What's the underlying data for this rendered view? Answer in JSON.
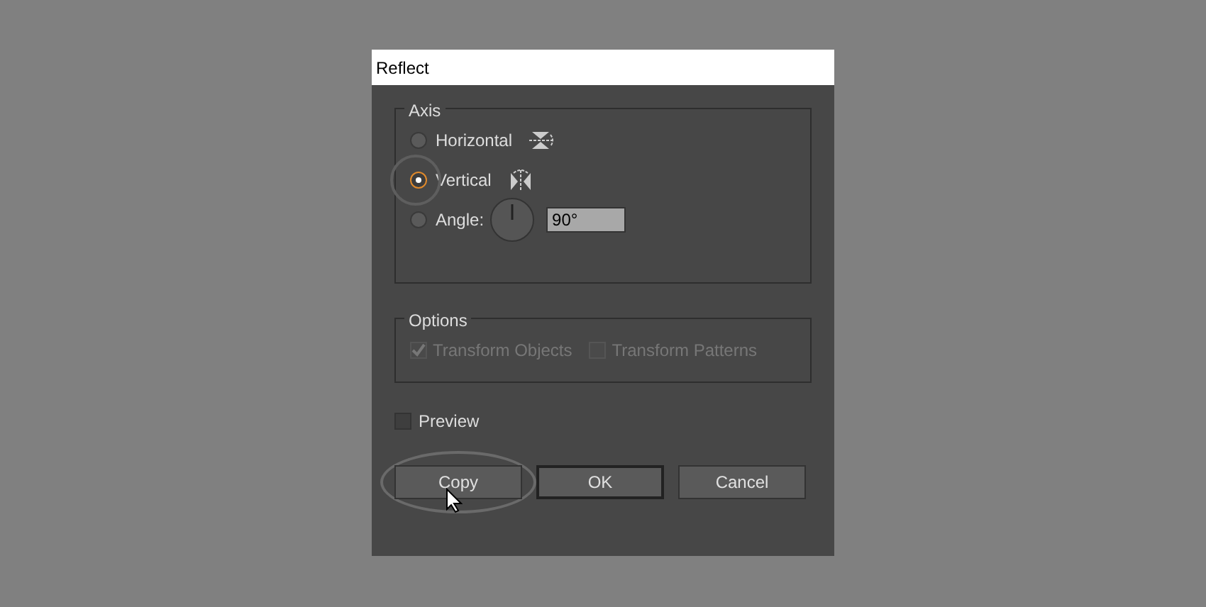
{
  "window": {
    "title": "Reflect"
  },
  "axis": {
    "label": "Axis",
    "options": [
      {
        "kind": "horizontal",
        "label": "Horizontal",
        "selected": false
      },
      {
        "kind": "vertical",
        "label": "Vertical",
        "selected": true
      },
      {
        "kind": "angle",
        "label": "Angle:",
        "selected": false,
        "value": "90°"
      }
    ]
  },
  "options": {
    "label": "Options",
    "checkboxes": [
      {
        "label": "Transform Objects",
        "checked": true,
        "disabled": true
      },
      {
        "label": "Transform Patterns",
        "checked": false,
        "disabled": true
      }
    ]
  },
  "preview": {
    "label": "Preview",
    "checked": false
  },
  "buttons": [
    {
      "label": "Copy",
      "default": false,
      "highlighted": true
    },
    {
      "label": "OK",
      "default": true,
      "highlighted": false
    },
    {
      "label": "Cancel",
      "default": false,
      "highlighted": false
    }
  ]
}
